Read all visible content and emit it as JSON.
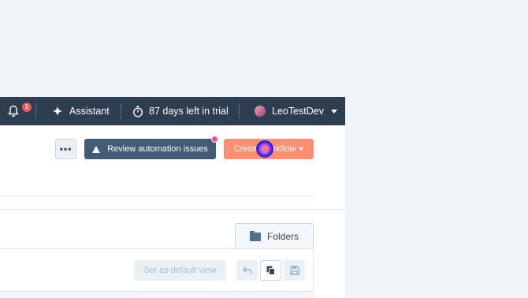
{
  "topbar": {
    "notifications": {
      "count": "1",
      "icon": "bell-icon"
    },
    "assistant": {
      "label": "Assistant",
      "icon": "sparkle-icon"
    },
    "trial": {
      "label": "87 days left in trial",
      "icon": "stopwatch-icon"
    },
    "account": {
      "name": "LeoTestDev",
      "icon": "avatar"
    }
  },
  "actions": {
    "more_label": "•••",
    "review_label": "Review automation issues",
    "create_label": "Create workflow"
  },
  "folders_tab": {
    "label": "Folders",
    "icon": "folder-icon"
  },
  "view_controls": {
    "default_view_label": "Set as default view",
    "undo_icon": "undo-icon",
    "clone_icon": "copy-icon",
    "save_icon": "save-icon"
  },
  "colors": {
    "topbar_bg": "#2d3e50",
    "primary": "#425b76",
    "accent": "#ff8f73",
    "badge": "#f2545b"
  }
}
